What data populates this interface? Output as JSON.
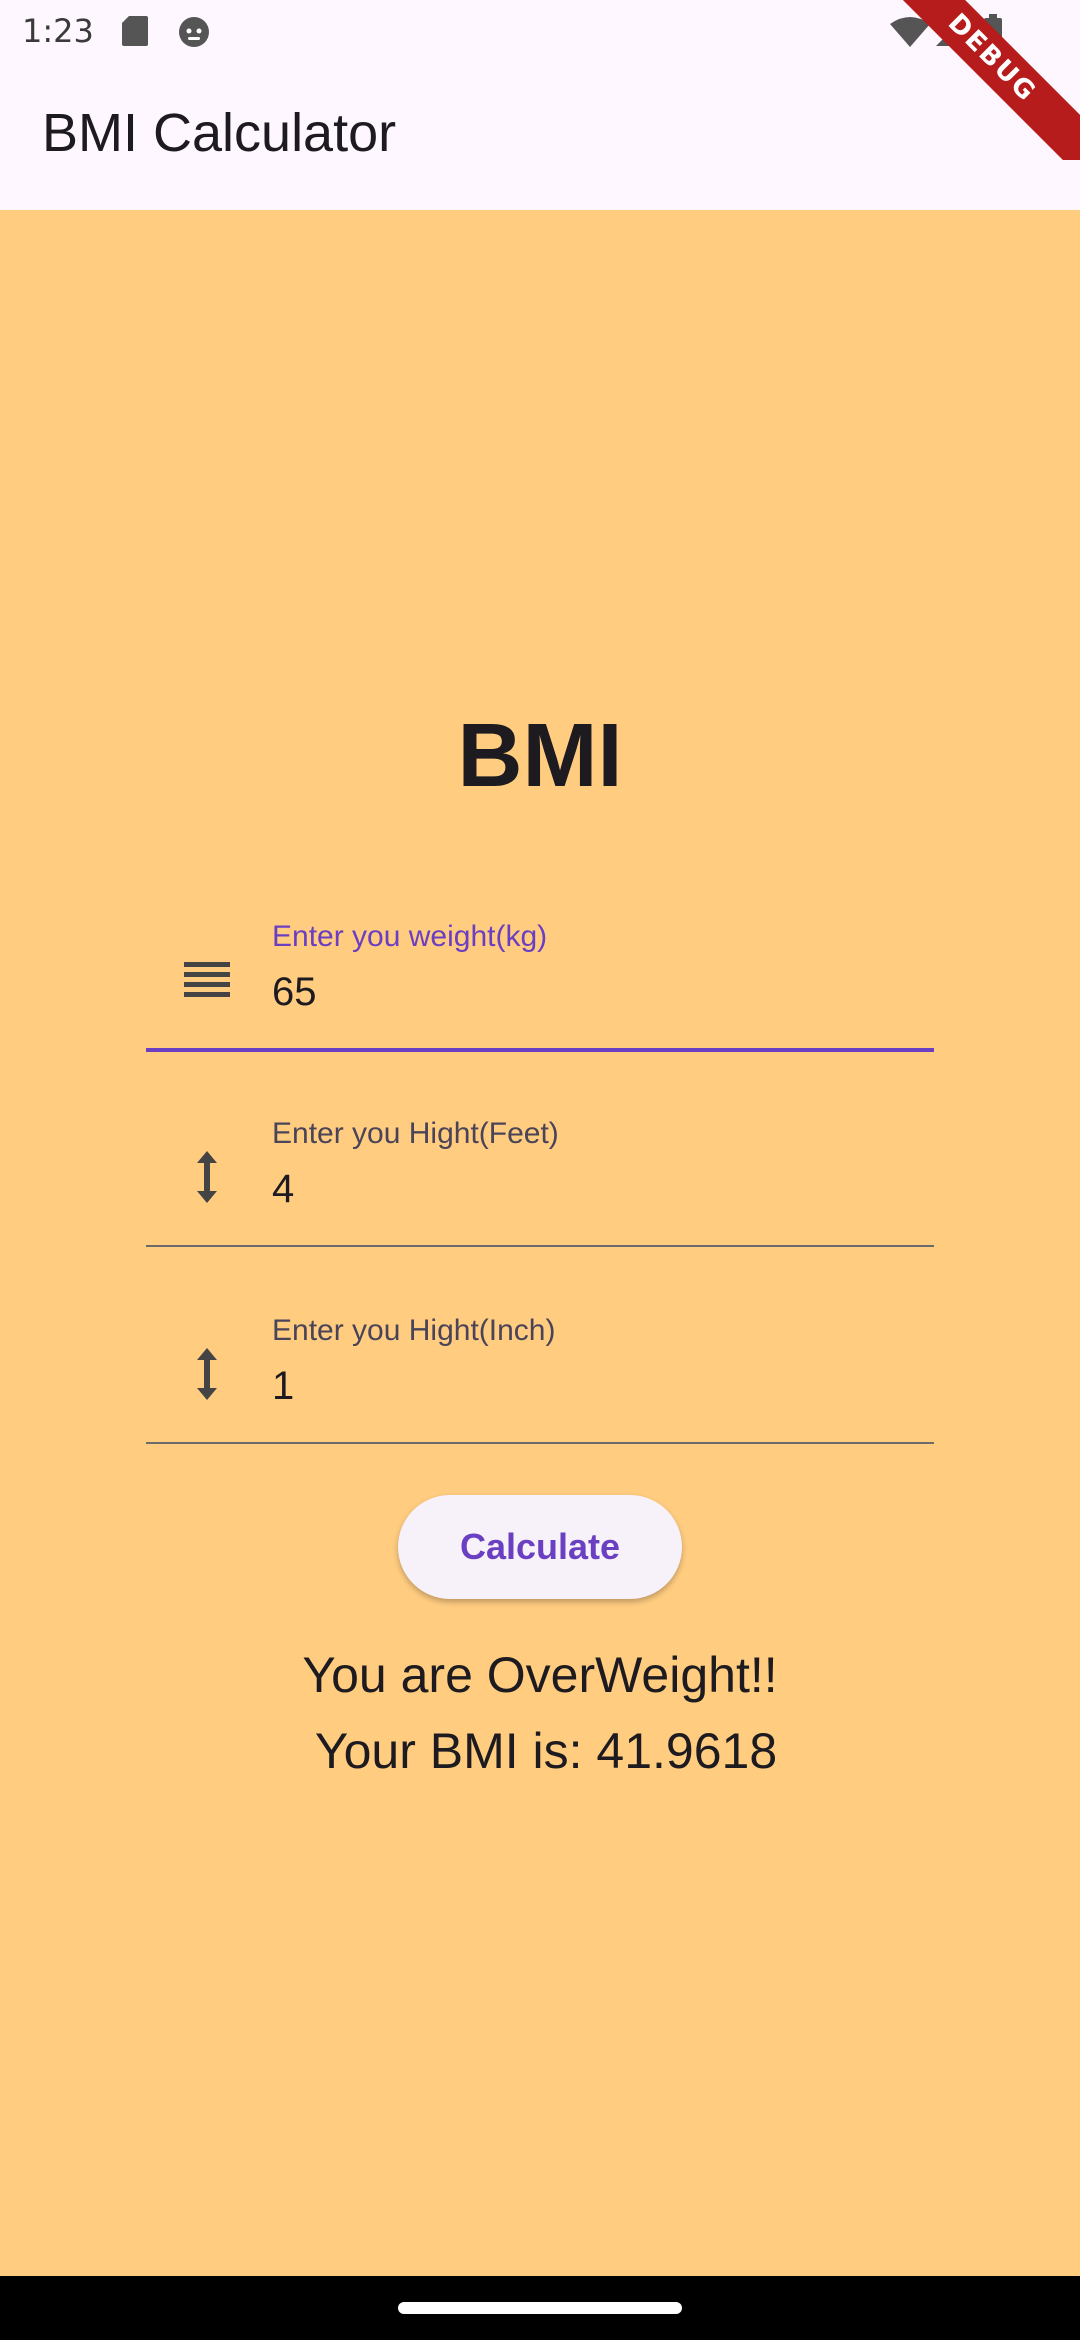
{
  "status_bar": {
    "time": "1:23",
    "icons": [
      "sd-card-icon",
      "robot-face-icon",
      "wifi-icon",
      "cell-signal-icon",
      "battery-icon"
    ]
  },
  "app_bar": {
    "title": "BMI Calculator"
  },
  "debug_banner": {
    "label": "DEBUG"
  },
  "main": {
    "heading": "BMI",
    "fields": [
      {
        "label": "Enter you weight(kg)",
        "value": "65",
        "icon": "weight-lines-icon",
        "focused": true
      },
      {
        "label": "Enter you Hight(Feet)",
        "value": "4",
        "icon": "vertical-arrows-icon",
        "focused": false
      },
      {
        "label": "Enter you Hight(Inch)",
        "value": "1",
        "icon": "vertical-arrows-icon",
        "focused": false
      }
    ],
    "calculate_label": "Calculate",
    "result_line1": "You are OverWeight!!",
    "result_line2": "Your BMI is: 41.9618"
  },
  "colors": {
    "background": "#FFCC80",
    "app_bar": "#FEF7FF",
    "accent": "#6A3FC1",
    "debug": "#B71C1C"
  }
}
